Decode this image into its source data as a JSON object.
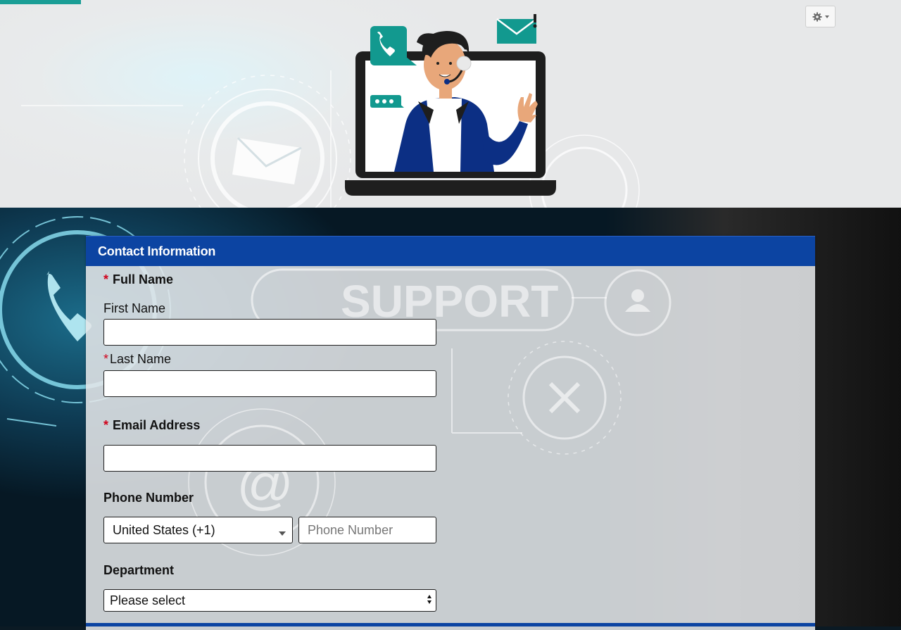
{
  "header": {
    "progress_percent": 9,
    "settings_icon": "gear-icon",
    "settings_caret_icon": "caret-down-icon"
  },
  "background": {
    "watermark_text": "SUPPORT",
    "icons": [
      "envelope-icon",
      "phone-icon",
      "at-sign-icon",
      "tools-icon",
      "user-icon"
    ]
  },
  "form": {
    "section_title": "Contact Information",
    "full_name": {
      "label": "Full Name",
      "required_mark": "*",
      "first_name_label": "First Name",
      "first_name_value": "",
      "last_name_label": "Last Name",
      "last_name_value": ""
    },
    "email": {
      "label": "Email Address",
      "required_mark": "*",
      "value": ""
    },
    "phone": {
      "label": "Phone Number",
      "country_value": "United States (+1)",
      "number_placeholder": "Phone Number",
      "number_value": ""
    },
    "department": {
      "label": "Department",
      "selected": "Please select"
    }
  },
  "colors": {
    "accent_teal": "#1a9e96",
    "section_blue": "#0c44a2",
    "required_red": "#d0021b"
  }
}
